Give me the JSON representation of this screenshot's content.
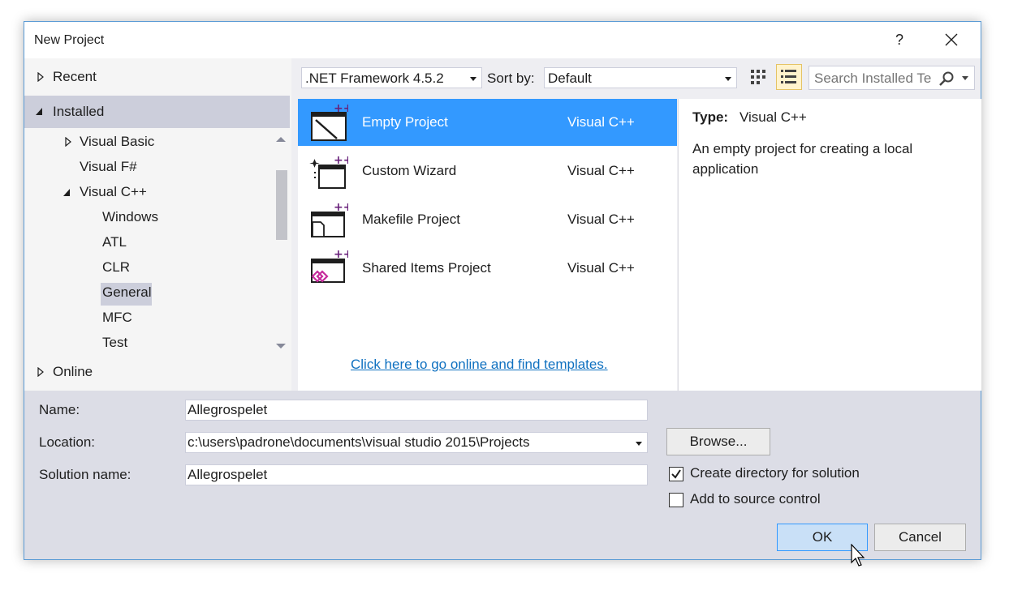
{
  "window": {
    "title": "New Project",
    "help_label": "?"
  },
  "tree": {
    "recent": "Recent",
    "installed": "Installed",
    "online": "Online",
    "items": [
      {
        "label": "Visual Basic"
      },
      {
        "label": "Visual F#"
      },
      {
        "label": "Visual C++"
      },
      {
        "label": "Windows"
      },
      {
        "label": "ATL"
      },
      {
        "label": "CLR"
      },
      {
        "label": "General"
      },
      {
        "label": "MFC"
      },
      {
        "label": "Test"
      }
    ],
    "selected": "General"
  },
  "toolbar": {
    "framework": ".NET Framework 4.5.2",
    "sort_label": "Sort by:",
    "sort_value": "Default",
    "search_placeholder": "Search Installed Te"
  },
  "templates": [
    {
      "name": "Empty Project",
      "lang": "Visual C++",
      "icon": "empty-project-icon"
    },
    {
      "name": "Custom Wizard",
      "lang": "Visual C++",
      "icon": "custom-wizard-icon"
    },
    {
      "name": "Makefile Project",
      "lang": "Visual C++",
      "icon": "makefile-project-icon"
    },
    {
      "name": "Shared Items Project",
      "lang": "Visual C++",
      "icon": "shared-items-icon"
    }
  ],
  "online_link": "Click here to go online and find templates.",
  "description": {
    "type_label": "Type:",
    "type_value": "Visual C++",
    "text": "An empty project for creating a local application"
  },
  "form": {
    "name_label": "Name:",
    "name_value": "Allegrospelet",
    "location_label": "Location:",
    "location_value": "c:\\users\\padrone\\documents\\visual studio 2015\\Projects",
    "solution_label": "Solution name:",
    "solution_value": "Allegrospelet",
    "browse_label": "Browse...",
    "create_dir_label": "Create directory for solution",
    "create_dir_checked": true,
    "source_control_label": "Add to source control",
    "source_control_checked": false,
    "ok_label": "OK",
    "cancel_label": "Cancel"
  },
  "colors": {
    "accent": "#3399ff",
    "link": "#0e70c0",
    "border": "#5b9bd5"
  }
}
